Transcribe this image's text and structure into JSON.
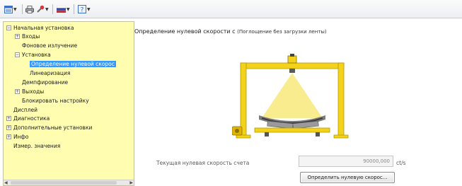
{
  "tree": {
    "items": [
      {
        "label": "Начальная установка",
        "expander": "−"
      },
      {
        "label": "Входы",
        "expander": "+"
      },
      {
        "label": "Фоновое излучение",
        "expander": ""
      },
      {
        "label": "Установка",
        "expander": "−"
      },
      {
        "label": "Определение нулевой скорос",
        "expander": ""
      },
      {
        "label": "Линеаризация",
        "expander": ""
      },
      {
        "label": "Демпфирование",
        "expander": ""
      },
      {
        "label": "Выходы",
        "expander": "+"
      },
      {
        "label": "Блокировать настройку",
        "expander": ""
      },
      {
        "label": "Дисплей",
        "expander": ""
      },
      {
        "label": "Диагностика",
        "expander": "+"
      },
      {
        "label": "Дополнительные установки",
        "expander": "+"
      },
      {
        "label": "Инфо",
        "expander": "+"
      },
      {
        "label": "Измер. значения",
        "expander": ""
      }
    ]
  },
  "main": {
    "title": "Определение нулевой скорости с",
    "subtitle": "(Поглощение без загрузки ленты)",
    "current_label": "Текущая нулевая скорость счета",
    "current_value": "90000,000",
    "unit": "ct/s",
    "detect_button": "Определить нулевую скорос..."
  },
  "colors": {
    "tree_bg": "#fffdb0",
    "selection": "#3399ff",
    "frame_yellow": "#f2d21a"
  },
  "icons": [
    "view-menu-icon",
    "printer-icon",
    "tools-icon",
    "flag-language-icon",
    "help-icon"
  ]
}
